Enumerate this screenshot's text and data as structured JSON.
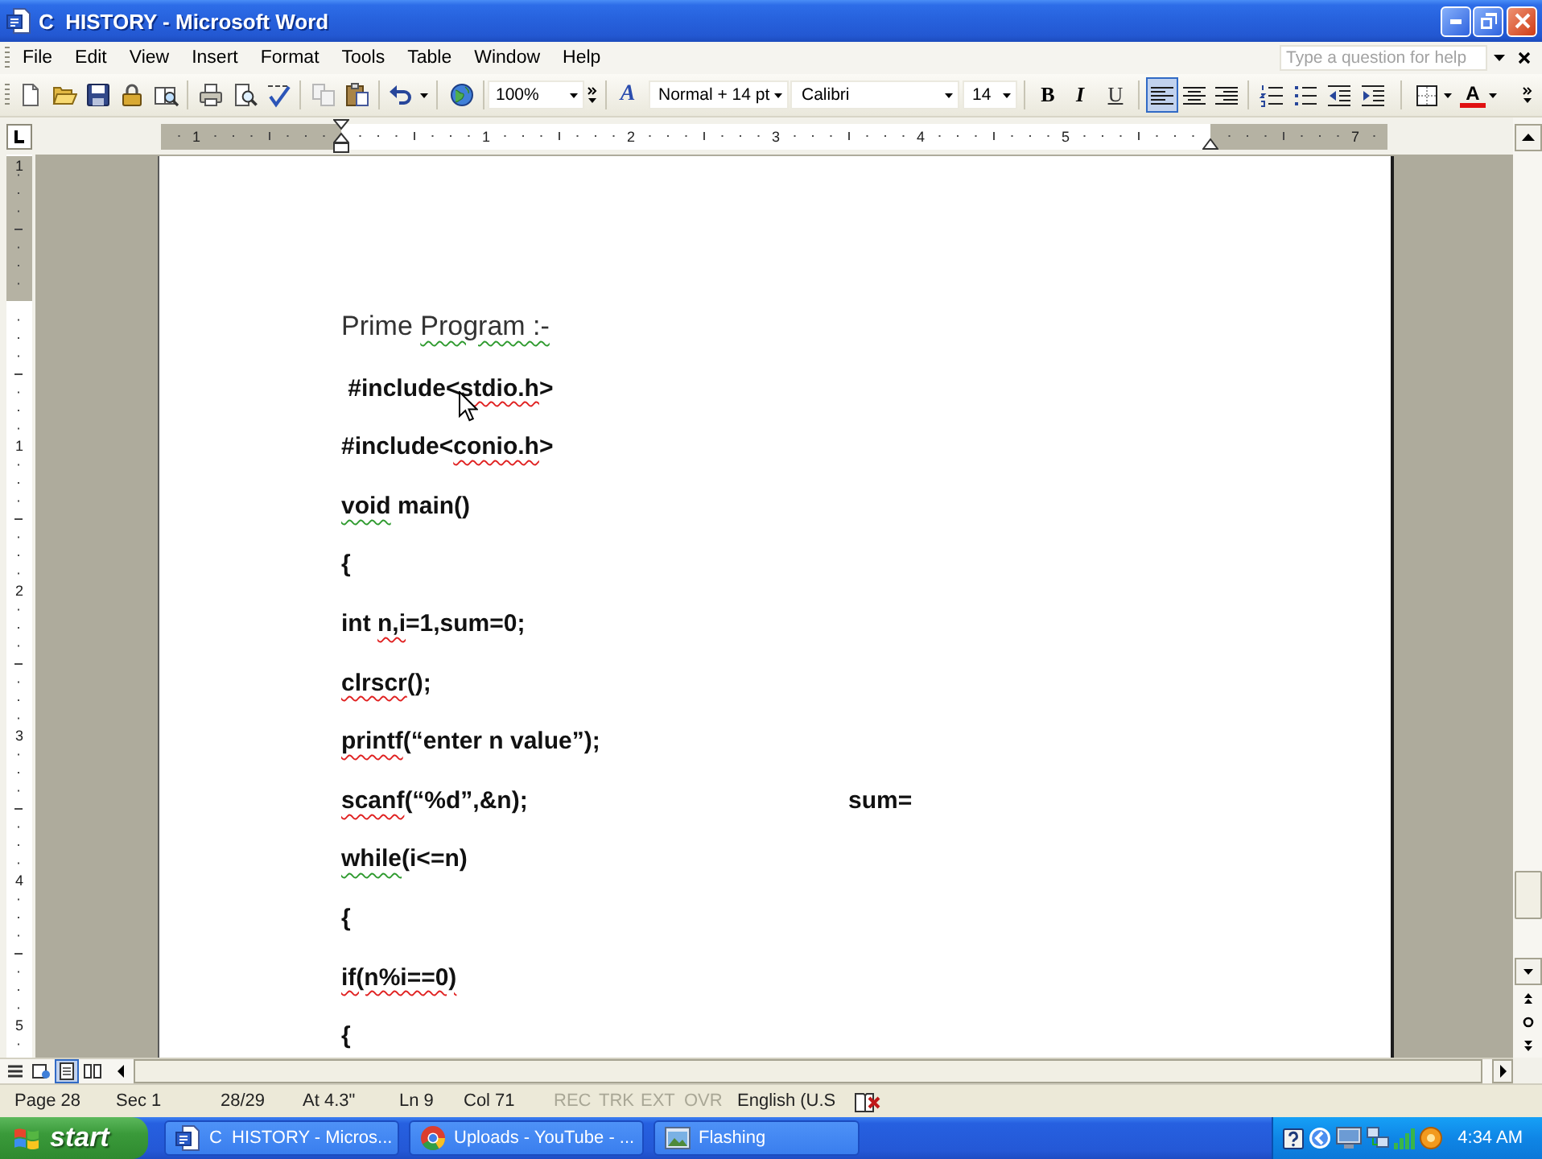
{
  "window": {
    "title": "C  HISTORY - Microsoft Word"
  },
  "menu_bar": {
    "items": [
      "File",
      "Edit",
      "View",
      "Insert",
      "Format",
      "Tools",
      "Table",
      "Window",
      "Help"
    ],
    "help_box": {
      "placeholder": "Type a question for help"
    }
  },
  "toolbar": {
    "zoom": "100%",
    "styles_glyph": "A",
    "style": "Normal + 14 pt",
    "font": "Calibri",
    "size": "14",
    "format_buttons": [
      {
        "kind": "bold",
        "label": "B"
      },
      {
        "kind": "italic",
        "label": "I"
      },
      {
        "kind": "underline",
        "label": "U"
      }
    ],
    "alignment": [
      {
        "kind": "left",
        "selected": true
      },
      {
        "kind": "center",
        "selected": false
      },
      {
        "kind": "right",
        "selected": false
      }
    ],
    "font_color_glyph": "A"
  },
  "horizontal_ruler": {
    "labels": [
      "1",
      "1",
      "2",
      "3",
      "4",
      "5",
      "7"
    ]
  },
  "vertical_ruler": {
    "labels": [
      "1",
      "1",
      "2",
      "3",
      "4",
      "5"
    ]
  },
  "document": {
    "lines": [
      {
        "kind": "heading",
        "segments": [
          {
            "text": "Prime ",
            "kind": "plain"
          },
          {
            "text": "Program :-",
            "kind": "grammar"
          }
        ]
      },
      {
        "kind": "code",
        "segments": [
          {
            "text": " #include<",
            "kind": "plain"
          },
          {
            "text": "stdio.h",
            "kind": "spelling"
          },
          {
            "text": ">",
            "kind": "plain"
          }
        ]
      },
      {
        "kind": "code",
        "segments": [
          {
            "text": "#include<",
            "kind": "plain"
          },
          {
            "text": "conio.h",
            "kind": "spelling"
          },
          {
            "text": ">",
            "kind": "plain"
          }
        ]
      },
      {
        "kind": "code",
        "segments": [
          {
            "text": "void",
            "kind": "grammar"
          },
          {
            "text": " main()",
            "kind": "plain"
          }
        ]
      },
      {
        "kind": "code",
        "segments": [
          {
            "text": "{",
            "kind": "plain"
          }
        ]
      },
      {
        "kind": "code",
        "segments": [
          {
            "text": "int ",
            "kind": "plain"
          },
          {
            "text": "n,i",
            "kind": "spelling"
          },
          {
            "text": "=1,sum=0;",
            "kind": "plain"
          }
        ]
      },
      {
        "kind": "code",
        "segments": [
          {
            "text": "clrscr",
            "kind": "spelling"
          },
          {
            "text": "();",
            "kind": "plain"
          }
        ]
      },
      {
        "kind": "code",
        "segments": [
          {
            "text": "printf",
            "kind": "spelling"
          },
          {
            "text": "(“enter n value”);",
            "kind": "plain"
          }
        ]
      },
      {
        "kind": "code",
        "segments": [
          {
            "text": "scanf",
            "kind": "spelling"
          },
          {
            "text": "(“%d”,&n);",
            "kind": "plain"
          }
        ],
        "aside": "sum="
      },
      {
        "kind": "code",
        "segments": [
          {
            "text": "while",
            "kind": "grammar"
          },
          {
            "text": "(i<=n)",
            "kind": "plain"
          }
        ]
      },
      {
        "kind": "code",
        "segments": [
          {
            "text": "{",
            "kind": "plain"
          }
        ]
      },
      {
        "kind": "code",
        "segments": [
          {
            "text": "if(n%i==0)",
            "kind": "spelling"
          }
        ]
      },
      {
        "kind": "code",
        "segments": [
          {
            "text": "{",
            "kind": "plain"
          }
        ]
      }
    ]
  },
  "view_buttons": [
    {
      "kind": "normal",
      "selected": false
    },
    {
      "kind": "web",
      "selected": false
    },
    {
      "kind": "print",
      "selected": true
    },
    {
      "kind": "reading",
      "selected": false
    }
  ],
  "status_bar": {
    "fields": [
      "Page 28",
      "Sec 1",
      "28/29",
      "At 4.3\"",
      "Ln 9",
      "Col 71"
    ],
    "modes": [
      {
        "label": "REC",
        "on": false
      },
      {
        "label": "TRK",
        "on": false
      },
      {
        "label": "EXT",
        "on": false
      },
      {
        "label": "OVR",
        "on": false
      }
    ],
    "language": "English (U.S"
  },
  "taskbar": {
    "start": "start",
    "tasks": [
      {
        "kind": "document",
        "label": "C  HISTORY - Micros..."
      },
      {
        "kind": "browser",
        "label": "Uploads - YouTube - ..."
      },
      {
        "kind": "image",
        "label": "Flashing"
      }
    ],
    "clock": "4:34 AM"
  }
}
